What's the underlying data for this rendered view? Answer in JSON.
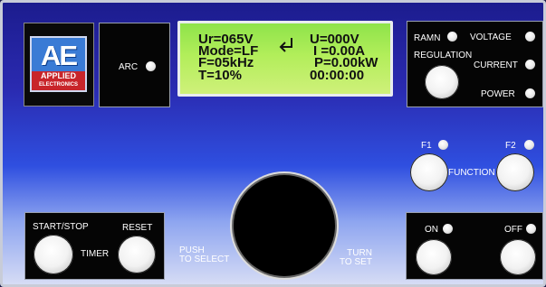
{
  "logo": {
    "mark": "AE",
    "line1": "APPLIED",
    "line2": "ELECTRONICS"
  },
  "arc": {
    "label": "ARC"
  },
  "display": {
    "ur": "Ur=065V",
    "mode": "Mode=LF",
    "freq": "F=05kHz",
    "time_pct": "T=10%",
    "u": "U=000V",
    "i": "I =0.00A",
    "p": "P=0.00kW",
    "clock": "00:00:00"
  },
  "regulation": {
    "ramn": "RAMN",
    "voltage": "VOLTAGE",
    "label": "REGULATION",
    "current": "CURRENT",
    "power": "POWER"
  },
  "function": {
    "f1": "F1",
    "f2": "F2",
    "label": "FUNCTION"
  },
  "timer": {
    "start_stop": "START/STOP",
    "reset": "RESET",
    "label": "TIMER"
  },
  "select": {
    "push_line1": "PUSH",
    "push_line2": "TO SELECT",
    "turn_line1": "TURN",
    "turn_line2": "TO SET"
  },
  "power": {
    "on": "ON",
    "off": "OFF"
  }
}
